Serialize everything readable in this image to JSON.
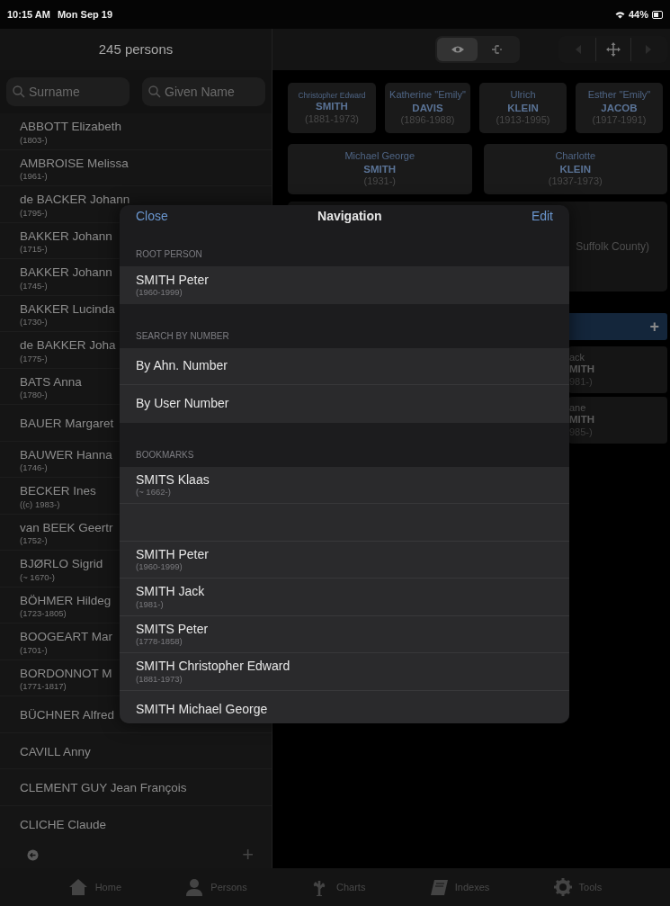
{
  "status_bar": {
    "time": "10:15 AM",
    "date": "Mon Sep 19",
    "battery": "44%"
  },
  "persons_panel": {
    "title": "245 persons",
    "search_fields": [
      {
        "placeholder": "Surname"
      },
      {
        "placeholder": "Given Name"
      }
    ],
    "rows": [
      {
        "name": "ABBOTT Elizabeth",
        "dates": "(1803-)"
      },
      {
        "name": "AMBROISE Melissa",
        "dates": "(1961-)"
      },
      {
        "name": "de BACKER Johann",
        "dates": "(1795-)"
      },
      {
        "name": "BAKKER Johann",
        "dates": "(1715-)"
      },
      {
        "name": "BAKKER Johann",
        "dates": "(1745-)"
      },
      {
        "name": "BAKKER Lucinda",
        "dates": "(1730-)"
      },
      {
        "name": "de BAKKER Joha",
        "dates": "(1775-)"
      },
      {
        "name": "BATS Anna",
        "dates": "(1780-)"
      },
      {
        "name": "BAUER Margaret"
      },
      {
        "name": "BAUWER Hanna",
        "dates": "(1746-)"
      },
      {
        "name": "BECKER Ines",
        "dates": "((c) 1983-)"
      },
      {
        "name": "van BEEK Geertr",
        "dates": "(1752-)"
      },
      {
        "name": "BJØRLO Sigrid",
        "dates": "(~ 1670-)"
      },
      {
        "name": "BÖHMER Hildeg",
        "dates": "(1723-1805)"
      },
      {
        "name": "BOOGEART Mar",
        "dates": "(1701-)"
      },
      {
        "name": "BORDONNOT M",
        "dates": "(1771-1817)"
      },
      {
        "name": "BÜCHNER Alfred"
      },
      {
        "name": "CAVILL Anny"
      },
      {
        "name": "CLEMENT GUY Jean François"
      },
      {
        "name": "CLICHE Claude"
      }
    ]
  },
  "chart_toolbar": {
    "view_modes": [
      {
        "kind": "eye",
        "selected": true
      },
      {
        "kind": "branch",
        "selected": false
      }
    ],
    "nav_buttons": [
      {
        "kind": "back",
        "disabled": true
      },
      {
        "kind": "move",
        "disabled": false
      },
      {
        "kind": "forward",
        "disabled": true
      }
    ]
  },
  "chart": {
    "grandparents": [
      {
        "given": "Christopher Edward",
        "surname": "SMITH",
        "dates": "(1881-1973)"
      },
      {
        "given": "Katherine \"Emily\"",
        "surname": "DAVIS",
        "dates": "(1896-1988)"
      },
      {
        "given": "Ulrich",
        "surname": "KLEIN",
        "dates": "(1913-1995)"
      },
      {
        "given": "Esther \"Emily\"",
        "surname": "JACOB",
        "dates": "(1917-1991)"
      }
    ],
    "parents": [
      {
        "given": "Michael George",
        "surname": "SMITH",
        "dates": "(1931-)"
      },
      {
        "given": "Charlotte",
        "surname": "KLEIN",
        "dates": "(1937-1973)"
      }
    ],
    "event_text": "Suffolk County)",
    "children_bar": {
      "add": "+"
    },
    "children": [
      {
        "given": "ack",
        "surname": "MITH",
        "dates": "981-)"
      },
      {
        "given": "ane",
        "surname": "MITH",
        "dates": "985-)"
      }
    ]
  },
  "navigation_dialog": {
    "close": "Close",
    "title": "Navigation",
    "edit": "Edit",
    "sections": [
      {
        "header": "ROOT PERSON",
        "rows": [
          {
            "kind": "person",
            "name": "SMITH Peter",
            "dates": "(1960-1999)"
          }
        ]
      },
      {
        "header": "SEARCH BY NUMBER",
        "rows": [
          {
            "kind": "action",
            "name": "By Ahn. Number"
          },
          {
            "kind": "action",
            "name": "By User Number"
          }
        ]
      },
      {
        "header": "BOOKMARKS",
        "rows": [
          {
            "kind": "person",
            "name": "SMITS Klaas",
            "dates": "(~ 1662-)"
          },
          {
            "kind": "blank"
          },
          {
            "kind": "person",
            "name": "SMITH Peter",
            "dates": "(1960-1999)"
          },
          {
            "kind": "person",
            "name": "SMITH Jack",
            "dates": "(1981-)"
          },
          {
            "kind": "person",
            "name": "SMITS Peter",
            "dates": "(1778-1858)"
          },
          {
            "kind": "person",
            "name": "SMITH Christopher Edward",
            "dates": "(1881-1973)"
          },
          {
            "kind": "action",
            "name": "SMITH Michael George"
          }
        ]
      }
    ]
  },
  "left_footer": {
    "add": "+"
  },
  "tab_bar": [
    {
      "kind": "home",
      "label": "Home",
      "selected": false
    },
    {
      "kind": "person",
      "label": "Persons",
      "selected": false
    },
    {
      "kind": "tree",
      "label": "Charts",
      "selected": false
    },
    {
      "kind": "book",
      "label": "Indexes",
      "selected": false
    },
    {
      "kind": "gear",
      "label": "Tools",
      "selected": false
    }
  ]
}
